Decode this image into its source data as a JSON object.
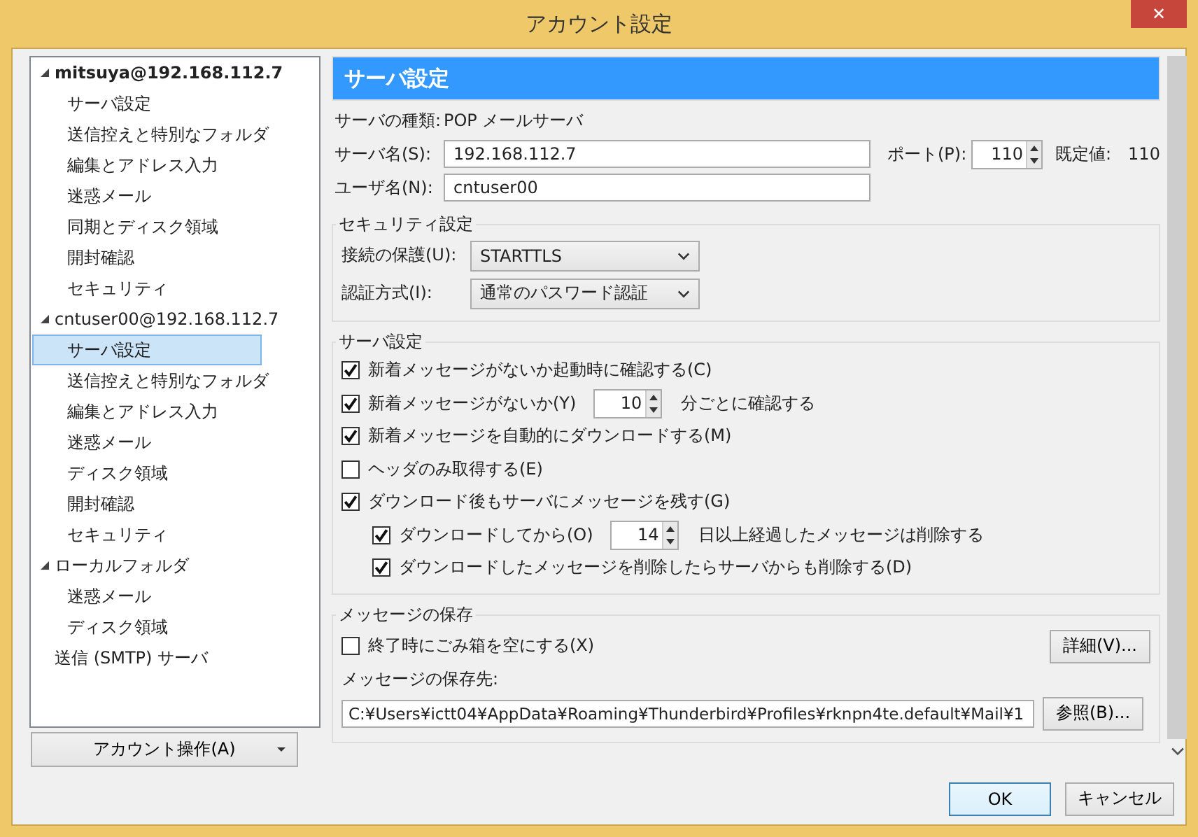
{
  "window": {
    "title": "アカウント設定",
    "close": "✕"
  },
  "sidebar": {
    "tree": [
      {
        "label": "mitsuya@192.168.112.7",
        "bold": true,
        "expanded": true,
        "selected": false,
        "children": [
          {
            "label": "サーバ設定",
            "selected": false
          },
          {
            "label": "送信控えと特別なフォルダ",
            "selected": false
          },
          {
            "label": "編集とアドレス入力",
            "selected": false
          },
          {
            "label": "迷惑メール",
            "selected": false
          },
          {
            "label": "同期とディスク領域",
            "selected": false
          },
          {
            "label": "開封確認",
            "selected": false
          },
          {
            "label": "セキュリティ",
            "selected": false
          }
        ]
      },
      {
        "label": "cntuser00@192.168.112.7",
        "bold": false,
        "expanded": true,
        "selected": false,
        "children": [
          {
            "label": "サーバ設定",
            "selected": true
          },
          {
            "label": "送信控えと特別なフォルダ",
            "selected": false
          },
          {
            "label": "編集とアドレス入力",
            "selected": false
          },
          {
            "label": "迷惑メール",
            "selected": false
          },
          {
            "label": "ディスク領域",
            "selected": false
          },
          {
            "label": "開封確認",
            "selected": false
          },
          {
            "label": "セキュリティ",
            "selected": false
          }
        ]
      },
      {
        "label": "ローカルフォルダ",
        "bold": false,
        "expanded": true,
        "selected": false,
        "children": [
          {
            "label": "迷惑メール",
            "selected": false
          },
          {
            "label": "ディスク領域",
            "selected": false
          }
        ]
      },
      {
        "label": "送信 (SMTP) サーバ",
        "bold": false,
        "selected": false
      }
    ],
    "account_button": "アカウント操作(A)"
  },
  "panel": {
    "title": "サーバ設定",
    "server_type": {
      "label": "サーバの種類:",
      "value": "POP メールサーバ"
    },
    "server_name": {
      "label": "サーバ名(S):",
      "value": "192.168.112.7"
    },
    "port": {
      "label": "ポート(P):",
      "value": "110",
      "default_label": "既定値:",
      "default_value": "110"
    },
    "user_name": {
      "label": "ユーザ名(N):",
      "value": "cntuser00"
    },
    "security": {
      "title": "セキュリティ設定",
      "fields": [
        {
          "label": "接続の保護(U):",
          "value": "STARTTLS"
        },
        {
          "label": "認証方式(I):",
          "value": "通常のパスワード認証"
        }
      ]
    },
    "server_settings": {
      "title": "サーバ設定",
      "options": [
        {
          "label": "新着メッセージがないか起動時に確認する(C)",
          "checked": true
        },
        {
          "label": "新着メッセージがないか(Y)",
          "checked": true,
          "spinner": "10",
          "suffix": "分ごとに確認する"
        },
        {
          "label": "新着メッセージを自動的にダウンロードする(M)",
          "checked": true
        },
        {
          "label": "ヘッダのみ取得する(E)",
          "checked": false
        },
        {
          "label": "ダウンロード後もサーバにメッセージを残す(G)",
          "checked": true,
          "children": [
            {
              "label": "ダウンロードしてから(O)",
              "checked": true,
              "spinner": "14",
              "suffix": "日以上経過したメッセージは削除する"
            },
            {
              "label": "ダウンロードしたメッセージを削除したらサーバからも削除する(D)",
              "checked": true
            }
          ]
        }
      ]
    },
    "storage": {
      "title": "メッセージの保存",
      "empty_trash": {
        "label": "終了時にごみ箱を空にする(X)",
        "checked": false
      },
      "details_button": "詳細(V)...",
      "location_label": "メッセージの保存先:",
      "location": "C:¥Users¥ictt04¥AppData¥Roaming¥Thunderbird¥Profiles¥rknpn4te.default¥Mail¥1",
      "browse_button": "参照(B)..."
    }
  },
  "buttons": [
    {
      "label": "OK",
      "default": true
    },
    {
      "label": "キャンセル",
      "default": false
    }
  ]
}
